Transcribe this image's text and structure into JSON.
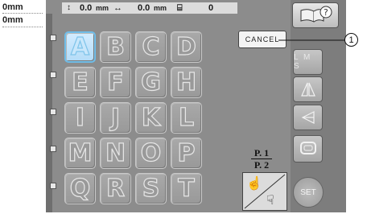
{
  "measurements": {
    "row1": "0mm",
    "row2": "0mm"
  },
  "status_bar": {
    "height_value": "0.0",
    "height_unit": "mm",
    "width_value": "0.0",
    "width_unit": "mm",
    "needle_count": "0"
  },
  "keys": [
    {
      "label": "A",
      "selected": true
    },
    {
      "label": "B"
    },
    {
      "label": "C"
    },
    {
      "label": "D"
    },
    {
      "label": "E"
    },
    {
      "label": "F"
    },
    {
      "label": "G"
    },
    {
      "label": "H"
    },
    {
      "label": "I"
    },
    {
      "label": "J"
    },
    {
      "label": "K"
    },
    {
      "label": "L"
    },
    {
      "label": "M"
    },
    {
      "label": "N"
    },
    {
      "label": "O"
    },
    {
      "label": "P"
    },
    {
      "label": "Q"
    },
    {
      "label": "R"
    },
    {
      "label": "S"
    },
    {
      "label": "T"
    }
  ],
  "cancel_label": "CANCEL",
  "pager": {
    "current": "P. 1",
    "total": "P. 2"
  },
  "sidebar": {
    "lms_label": "L M S",
    "set_label": "SET"
  },
  "callout_number": "1"
}
